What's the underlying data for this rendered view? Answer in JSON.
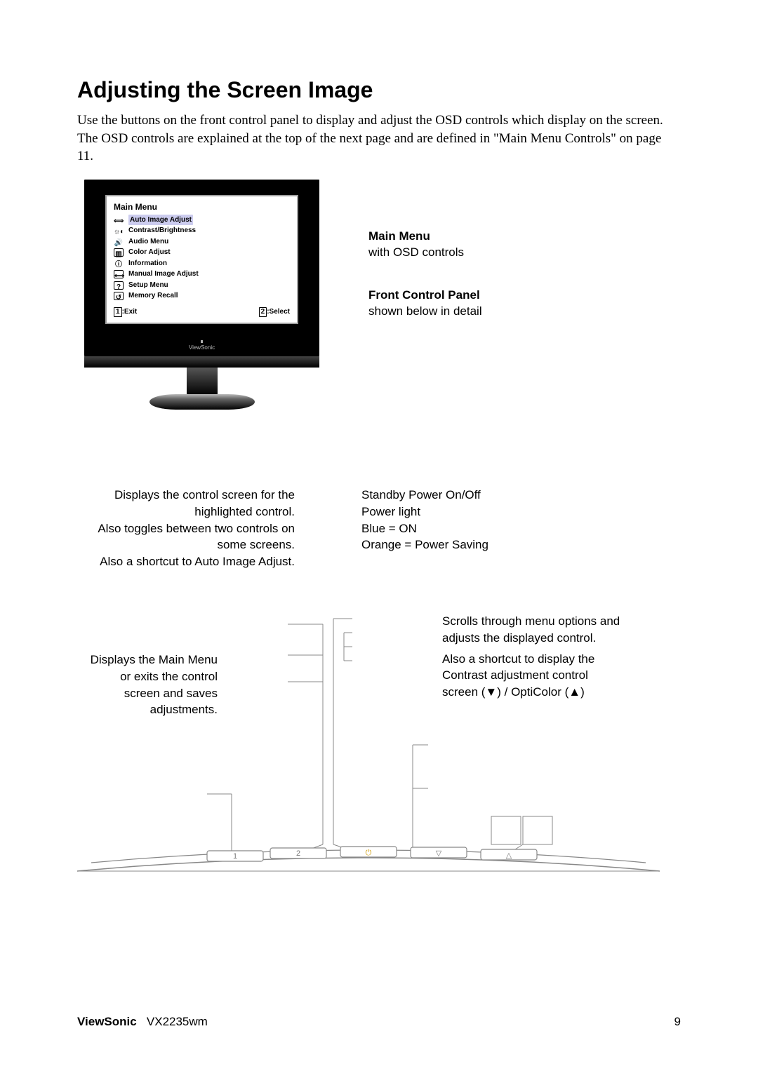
{
  "title": "Adjusting the Screen Image",
  "intro": "Use the buttons on the front control panel to display and adjust the OSD controls which display on the screen. The OSD controls are explained at the top of the next page and are defined in \"Main Menu Controls\" on page 11.",
  "osd": {
    "title": "Main Menu",
    "items": [
      "Auto Image Adjust",
      "Contrast/Brightness",
      "Audio Menu",
      "Color Adjust",
      "Information",
      "Manual Image Adjust",
      "Setup Menu",
      "Memory Recall"
    ],
    "exit_key": "1",
    "exit": ":Exit",
    "select_key": "2",
    "select": ":Select"
  },
  "side": {
    "mm_title": "Main Menu",
    "mm_sub": "with OSD controls",
    "fcp_title": "Front Control Panel",
    "fcp_sub": "shown below in detail"
  },
  "callouts": {
    "left1": "Displays the control screen for the highlighted control.",
    "left2": "Also toggles between two controls on some screens.",
    "left3": "Also a shortcut to Auto Image Adjust.",
    "left4": "Displays the Main Menu or exits the control screen and saves adjustments.",
    "right1": "Standby Power On/Off",
    "right2": "Power light",
    "right3": "Blue = ON",
    "right4": "Orange = Power Saving",
    "right5": "Scrolls through menu options and adjusts the displayed control.",
    "right6": "Also a shortcut to display the Contrast adjustment control screen (▼) / OptiColor  (▲)"
  },
  "panel_keys": {
    "k1": "1",
    "k2": "2",
    "power": "⏻",
    "down": "▽",
    "up": "△"
  },
  "footer": {
    "brand": "ViewSonic",
    "model": "VX2235wm",
    "page": "9"
  },
  "chart_data": null
}
